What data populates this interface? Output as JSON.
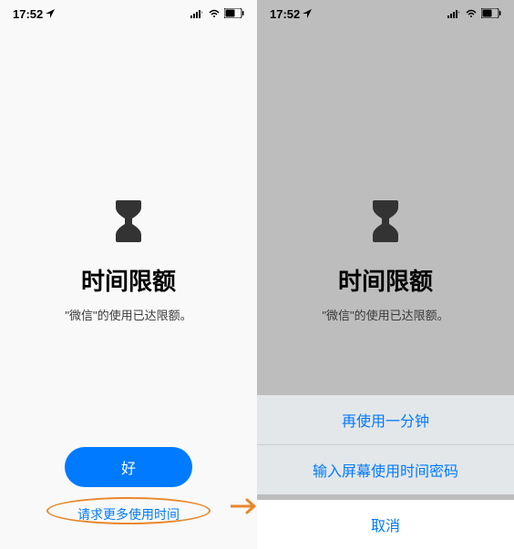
{
  "left": {
    "status": {
      "time": "17:52",
      "location_icon": "location-arrow"
    },
    "title": "时间限额",
    "subtitle": "\"微信\"的使用已达限额。",
    "primary_button": "好",
    "link_button": "请求更多使用时间"
  },
  "right": {
    "status": {
      "time": "17:52",
      "location_icon": "location-arrow"
    },
    "title": "时间限额",
    "subtitle": "\"微信\"的使用已达限额。",
    "action_sheet": {
      "option1": "再使用一分钟",
      "option2": "输入屏幕使用时间密码",
      "cancel": "取消"
    }
  },
  "icons": {
    "hourglass": "hourglass"
  }
}
